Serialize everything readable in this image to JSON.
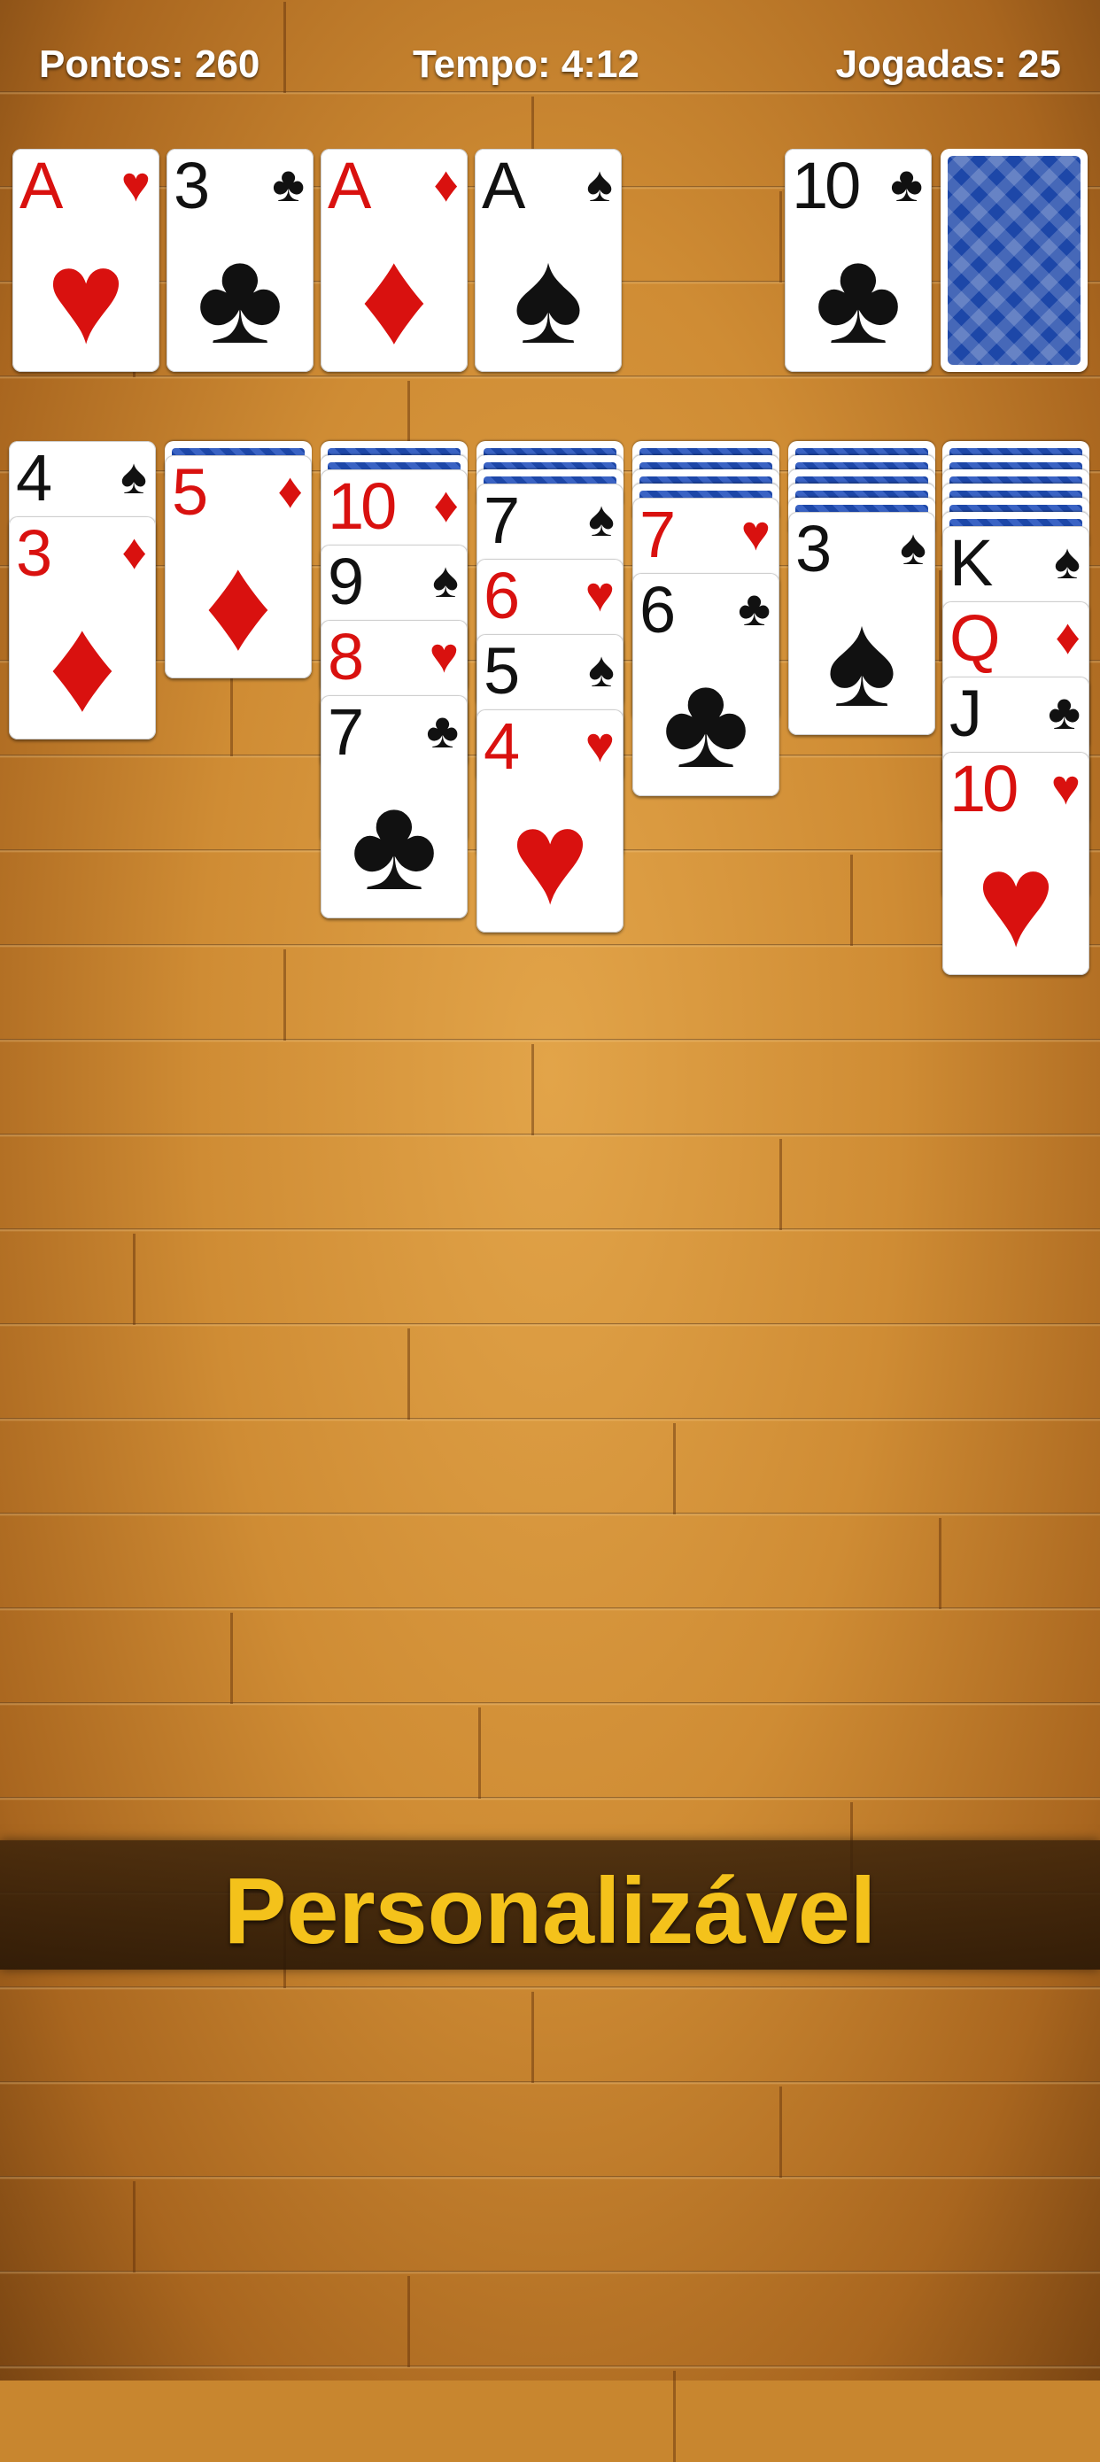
{
  "header": {
    "score": "Pontos: 260",
    "time": "Tempo: 4:12",
    "moves": "Jogadas: 25"
  },
  "foundations": [
    {
      "rank": "A",
      "suit": "♥",
      "color": "red"
    },
    {
      "rank": "3",
      "suit": "♣",
      "color": "black"
    },
    {
      "rank": "A",
      "suit": "♦",
      "color": "red"
    },
    {
      "rank": "A",
      "suit": "♠",
      "color": "black"
    }
  ],
  "waste": {
    "rank": "10",
    "suit": "♣",
    "color": "black"
  },
  "tableau": [
    {
      "hidden": 0,
      "cards": [
        {
          "rank": "4",
          "suit": "♠",
          "color": "black"
        },
        {
          "rank": "3",
          "suit": "♦",
          "color": "red"
        }
      ]
    },
    {
      "hidden": 1,
      "cards": [
        {
          "rank": "5",
          "suit": "♦",
          "color": "red"
        }
      ]
    },
    {
      "hidden": 2,
      "cards": [
        {
          "rank": "10",
          "suit": "♦",
          "color": "red"
        },
        {
          "rank": "9",
          "suit": "♠",
          "color": "black"
        },
        {
          "rank": "8",
          "suit": "♥",
          "color": "red"
        },
        {
          "rank": "7",
          "suit": "♣",
          "color": "black"
        }
      ]
    },
    {
      "hidden": 3,
      "cards": [
        {
          "rank": "7",
          "suit": "♠",
          "color": "black"
        },
        {
          "rank": "6",
          "suit": "♥",
          "color": "red"
        },
        {
          "rank": "5",
          "suit": "♠",
          "color": "black"
        },
        {
          "rank": "4",
          "suit": "♥",
          "color": "red"
        }
      ]
    },
    {
      "hidden": 4,
      "cards": [
        {
          "rank": "7",
          "suit": "♥",
          "color": "red"
        },
        {
          "rank": "6",
          "suit": "♣",
          "color": "black"
        }
      ]
    },
    {
      "hidden": 5,
      "cards": [
        {
          "rank": "3",
          "suit": "♠",
          "color": "black"
        }
      ]
    },
    {
      "hidden": 6,
      "cards": [
        {
          "rank": "K",
          "suit": "♠",
          "color": "black"
        },
        {
          "rank": "Q",
          "suit": "♦",
          "color": "red"
        },
        {
          "rank": "J",
          "suit": "♣",
          "color": "black"
        },
        {
          "rank": "10",
          "suit": "♥",
          "color": "red"
        }
      ]
    }
  ],
  "banner": {
    "text": "Personalizável"
  }
}
